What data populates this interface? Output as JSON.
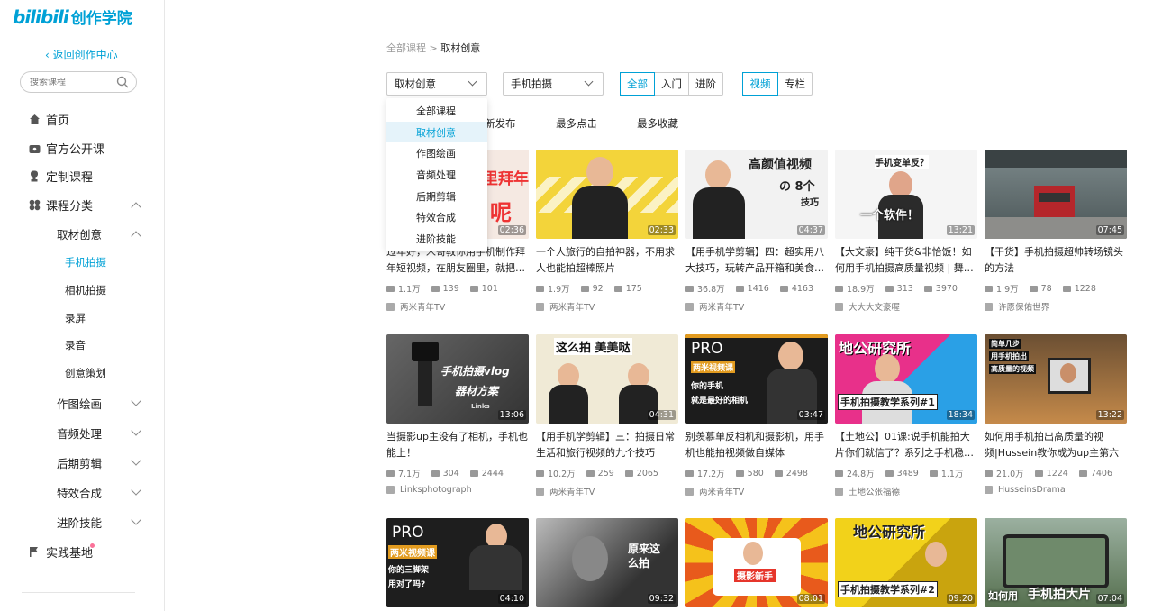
{
  "logo": {
    "brand": "bilibili",
    "product": "创作学院"
  },
  "back_link": "返回创作中心",
  "search": {
    "placeholder": "搜索课程"
  },
  "nav": {
    "home": "首页",
    "public": "官方公开课",
    "custom": "定制课程",
    "category": "课程分类",
    "sub": {
      "material": "取材创意",
      "drawing": "作图绘画",
      "audio": "音频处理",
      "editing": "后期剪辑",
      "effects": "特效合成",
      "advanced": "进阶技能"
    },
    "material_items": [
      "手机拍摄",
      "相机拍摄",
      "录屏",
      "录音",
      "创意策划"
    ],
    "practice": "实践基地"
  },
  "breadcrumb": {
    "root": "全部课程",
    "sep": " > ",
    "current": "取材创意"
  },
  "filters": {
    "category": "取材创意",
    "subcategory": "手机拍摄",
    "level": [
      "全部",
      "入门",
      "进阶"
    ],
    "type": [
      "视频",
      "专栏"
    ]
  },
  "dropdown": [
    "全部课程",
    "取材创意",
    "作图绘画",
    "音频处理",
    "后期剪辑",
    "特效合成",
    "进阶技能"
  ],
  "sort": [
    "新发布",
    "最多点击",
    "最多收藏"
  ],
  "cards": [
    {
      "title": "过年好，米哥教你用手机制作拜年短视频，在朋友圈里，就把…",
      "dur": "02:36",
      "plays": "1.1万",
      "danmaku": "139",
      "fav": "101",
      "author": "两米青年TV"
    },
    {
      "title": "一个人旅行的自拍神器，不用求人也能拍超棒照片",
      "dur": "02:33",
      "plays": "1.9万",
      "danmaku": "92",
      "fav": "175",
      "author": "两米青年TV"
    },
    {
      "title": "【用手机学剪辑】四：超实用八大技巧，玩转产品开箱和美食…",
      "dur": "04:37",
      "plays": "36.8万",
      "danmaku": "1416",
      "fav": "4163",
      "author": "两米青年TV"
    },
    {
      "title": "【大文豪】纯干货&非恰饭！如何用手机拍摄高质量视频 | 舞…",
      "dur": "13:21",
      "plays": "18.9万",
      "danmaku": "313",
      "fav": "3970",
      "author": "大大大文豪喔"
    },
    {
      "title": "【干货】手机拍摄超帅转场镜头的方法",
      "dur": "07:45",
      "plays": "1.9万",
      "danmaku": "78",
      "fav": "1228",
      "author": "许愿保佑世界"
    },
    {
      "title": "当摄影up主没有了相机，手机也能上！",
      "dur": "13:06",
      "plays": "7.1万",
      "danmaku": "304",
      "fav": "2444",
      "author": "Linksphotograph"
    },
    {
      "title": "【用手机学剪辑】三：拍摄日常生活和旅行视频的九个技巧",
      "dur": "04:31",
      "plays": "10.2万",
      "danmaku": "259",
      "fav": "2065",
      "author": "两米青年TV"
    },
    {
      "title": "别羡慕单反相机和摄影机，用手机也能拍视频做自媒体",
      "dur": "03:47",
      "plays": "17.2万",
      "danmaku": "580",
      "fav": "2498",
      "author": "两米青年TV"
    },
    {
      "title": "【土地公】01课:说手机能拍大片你们就信了？系列之手机稳…",
      "dur": "18:34",
      "plays": "24.8万",
      "danmaku": "3489",
      "fav": "1.1万",
      "author": "土地公张福德"
    },
    {
      "title": "如何用手机拍出高质量的视频|Hussein教你成为up主第六期",
      "dur": "13:22",
      "plays": "21.0万",
      "danmaku": "1224",
      "fav": "7406",
      "author": "HusseinsDrama"
    },
    {
      "dur": "04:10"
    },
    {
      "dur": "09:32"
    },
    {
      "dur": "08:01"
    },
    {
      "dur": "09:20"
    },
    {
      "dur": "07:04"
    }
  ],
  "thumb_text": {
    "c1": "里拜年",
    "c1b": "呢",
    "c3a": "高颜值视频",
    "c3b": "の 8个",
    "c3c": "技巧",
    "c4a": "手机变单反？",
    "c4b": "一个软件！",
    "c6a": "手机拍摄vlog",
    "c6b": "器材方案",
    "c6c": "Links",
    "c7": "这么拍 美美哒",
    "c8a": "PRO",
    "c8b": "两米视频课",
    "c8c": "你的手机",
    "c8d": "就是最好的相机",
    "c9a": "地公研究所",
    "c9b": "手机拍摄教学系列#1",
    "c10a": "简单几步",
    "c10b": "用手机拍出",
    "c10c": "高质量的视频",
    "c11a": "PRO",
    "c11b": "两米视频课",
    "c11c": "你的三脚架",
    "c11d": "用对了吗?",
    "c12": "原来这么拍",
    "c13": "摄影新手",
    "c14a": "地公研究所",
    "c14b": "手机拍摄教学系列#2",
    "c15a": "如何用",
    "c15b": "手机拍大片"
  }
}
